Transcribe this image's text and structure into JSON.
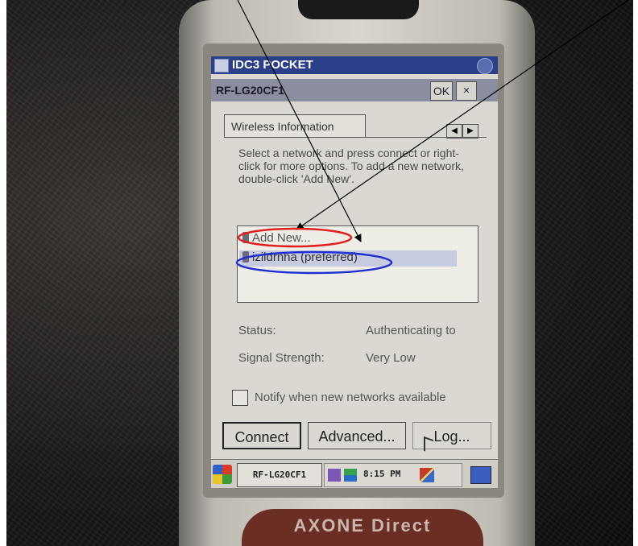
{
  "app_title": "IDC3 POCKET",
  "dialog": {
    "title": "RF-LG20CF1",
    "ok_label": "OK",
    "close_label": "×"
  },
  "tab": {
    "label": "Wireless Information",
    "prev_arrow": "◀",
    "next_arrow": "▶"
  },
  "instructions": "Select a network and press connect or right-click for more options.  To add a new network, double-click 'Add New'.",
  "networks": [
    {
      "label": "Add New..."
    },
    {
      "label": "izildrnha (preferred)"
    }
  ],
  "status": {
    "label": "Status:",
    "value": "Authenticating to"
  },
  "signal": {
    "label": "Signal Strength:",
    "value": "Very Low"
  },
  "notify_checkbox": {
    "label": "Notify when new networks available",
    "checked": false
  },
  "buttons": {
    "connect": "Connect",
    "advanced": "Advanced...",
    "log": "Log..."
  },
  "taskbar": {
    "task_label": "RF-LG20CF1",
    "time": "8:15 PM"
  },
  "brand": "AXONE Direct",
  "annotation_colors": {
    "add_new_ellipse": "#e02020",
    "preferred_ellipse": "#1f2fd0",
    "arrows": "#000000"
  },
  "icons": [
    "app-icon",
    "start-icon",
    "network-icon",
    "signal-icon",
    "pen-icon",
    "keyboard-icon"
  ]
}
